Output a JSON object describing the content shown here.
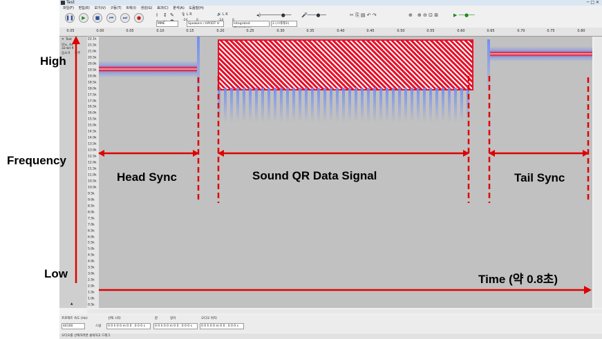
{
  "window": {
    "title": "Test"
  },
  "menu": [
    "파일(F)",
    "편집(E)",
    "보기(V)",
    "구동(T)",
    "트랙(I)",
    "생성(G)",
    "효과(C)",
    "분석(A)",
    "도움말(H)"
  ],
  "transport": {
    "pause": "❚❚",
    "play": "▶",
    "stop": "■",
    "skip_start": "⏮",
    "skip_end": "⏭",
    "record": "●"
  },
  "meters": {
    "record_db_a": "-24",
    "record_db_b": "0",
    "play_db_a": "-24",
    "play_db_b": "0"
  },
  "devices": {
    "host": "MME",
    "output": "Speakers / HP(IDT H",
    "input": "Integrated Microphone",
    "channels": "2 (스테레오)"
  },
  "ruler": {
    "ticks": [
      "0.05",
      "0.00",
      "0.05",
      "0.10",
      "0.15",
      "0.20",
      "0.25",
      "0.30",
      "0.35",
      "0.40",
      "0.45",
      "0.50",
      "0.55",
      "0.60",
      "0.65",
      "0.70",
      "0.75",
      "0.80"
    ]
  },
  "track": {
    "name": "Test",
    "info_a": "모노, 44",
    "info_b": "32-bit fl",
    "mute": "음소거",
    "solo": "독주"
  },
  "frequency_scale": [
    "22.1k",
    "21.5k",
    "21.0k",
    "20.5k",
    "20.0k",
    "19.5k",
    "19.0k",
    "18.5k",
    "18.0k",
    "17.5k",
    "17.0k",
    "16.5k",
    "16.0k",
    "15.5k",
    "15.0k",
    "14.5k",
    "14.0k",
    "13.5k",
    "13.0k",
    "12.5k",
    "12.0k",
    "11.5k",
    "11.0k",
    "10.5k",
    "10.0k",
    "9.5k",
    "9.0k",
    "8.5k",
    "8.0k",
    "7.5k",
    "7.0k",
    "6.5k",
    "6.0k",
    "5.5k",
    "5.0k",
    "4.5k",
    "4.0k",
    "3.5k",
    "3.0k",
    "2.5k",
    "2.0k",
    "1.5k",
    "1.0k",
    "0.5k"
  ],
  "selection": {
    "project_rate_label": "프로젝트 속도 (Hz):",
    "project_rate": "44100",
    "snap_label": "스냅",
    "start_label": "선택 시작:",
    "end_label": "끝",
    "length_label": "길이",
    "start_value": "0 0 h 0 0 m 0 0 . 0 0 0 s",
    "end_value": "0 0 h 0 0 m 0 0 . 0 0 0 s",
    "position_label": "오디오 위치:",
    "position_value": "0 0 h 0 0 m 0 0 . 0 0 0 s"
  },
  "status": {
    "text": "오디오를 선택하려면 클릭하고 드래그"
  },
  "annotations": {
    "high": "High",
    "frequency": "Frequency",
    "low": "Low",
    "head_sync": "Head Sync",
    "data_signal": "Sound QR Data Signal",
    "tail_sync": "Tail Sync",
    "time": "Time (약 0.8초)"
  },
  "colors": {
    "annotation_red": "#e00000",
    "spectrogram_bg": "#c1c1c1",
    "tone_red": "#e8102a",
    "tone_blue": "#6f8ff2"
  }
}
